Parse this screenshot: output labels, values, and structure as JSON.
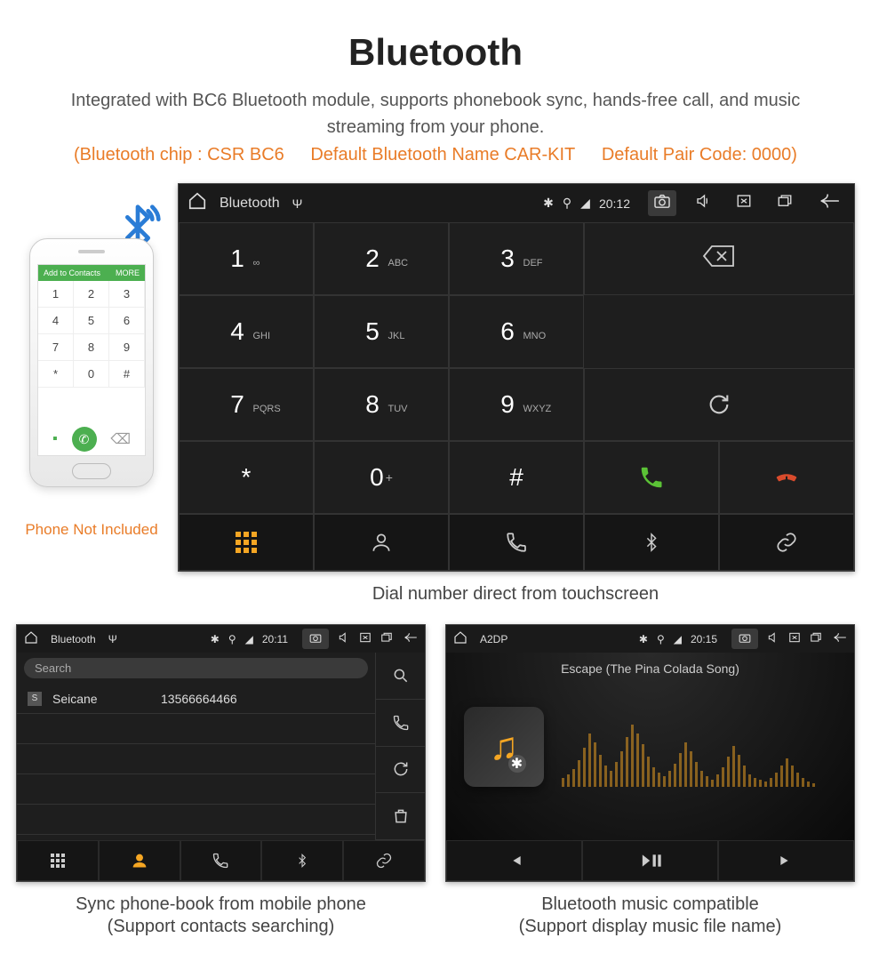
{
  "title": "Bluetooth",
  "subtitle": "Integrated with BC6 Bluetooth module, supports phonebook sync, hands-free call, and music streaming from your phone.",
  "specs": {
    "chip": "(Bluetooth chip : CSR BC6",
    "name": "Default Bluetooth Name CAR-KIT",
    "pair": "Default Pair Code: 0000)"
  },
  "phone": {
    "header_left": "Add to Contacts",
    "header_right": "MORE",
    "keys": [
      "1",
      "2",
      "3",
      "4",
      "5",
      "6",
      "7",
      "8",
      "9",
      "*",
      "0",
      "#"
    ],
    "caption": "Phone Not Included"
  },
  "dialer": {
    "status": {
      "app": "Bluetooth",
      "usb": "⏏",
      "time": "20:12"
    },
    "keys": [
      {
        "d": "1",
        "s": "∞"
      },
      {
        "d": "2",
        "s": "ABC"
      },
      {
        "d": "3",
        "s": "DEF"
      },
      {
        "d": "4",
        "s": "GHI"
      },
      {
        "d": "5",
        "s": "JKL"
      },
      {
        "d": "6",
        "s": "MNO"
      },
      {
        "d": "7",
        "s": "PQRS"
      },
      {
        "d": "8",
        "s": "TUV"
      },
      {
        "d": "9",
        "s": "WXYZ"
      },
      {
        "d": "*",
        "s": ""
      },
      {
        "d": "0",
        "s": "+",
        "sup": true
      },
      {
        "d": "#",
        "s": ""
      }
    ],
    "caption": "Dial number direct from touchscreen"
  },
  "contacts": {
    "status": {
      "app": "Bluetooth",
      "time": "20:11"
    },
    "search": "Search",
    "row": {
      "letter": "S",
      "name": "Seicane",
      "number": "13566664466"
    },
    "caption_l1": "Sync phone-book from mobile phone",
    "caption_l2": "(Support contacts searching)"
  },
  "music": {
    "status": {
      "app": "A2DP",
      "time": "20:15"
    },
    "track": "Escape (The Pina Colada Song)",
    "caption_l1": "Bluetooth music compatible",
    "caption_l2": "(Support display music file name)"
  }
}
